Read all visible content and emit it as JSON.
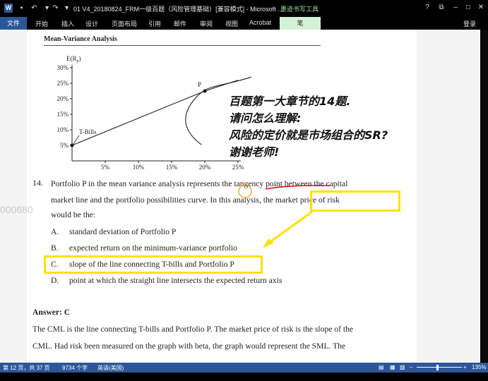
{
  "window": {
    "doc_title": "01 V4_20180824_FRM一级百题（风险管理基础）[兼容模式] - Microsoft ...",
    "tool_header": "墨迹书写工具",
    "controls": [
      "?",
      "⧉",
      "–",
      "□",
      "✕"
    ],
    "qat_icons": [
      "save-icon",
      "undo-icon",
      "redo-icon"
    ]
  },
  "ribbon": {
    "file_tab": "文件",
    "tabs": [
      "开始",
      "插入",
      "设计",
      "页面布局",
      "引用",
      "邮件",
      "审阅",
      "视图",
      "Acrobat"
    ],
    "pen_tab": "笔",
    "login": "登录"
  },
  "document": {
    "watermark": "000680",
    "section_title": "Mean-Variance Analysis",
    "chart_data": {
      "type": "line",
      "title": "Mean-Variance Analysis",
      "ylabel": "E(R",
      "ylabel_sub": "p",
      "ylabel_close": ")",
      "y_ticks": [
        "5%",
        "10%",
        "15%",
        "20%",
        "25%",
        "30%"
      ],
      "x_ticks": [
        "5%",
        "10%",
        "15%",
        "20%",
        "25%"
      ],
      "xlim": [
        0,
        25
      ],
      "ylim": [
        0,
        30
      ],
      "annotations": {
        "tbills": "T-Bills",
        "portfolio": "P"
      },
      "series": [
        {
          "values": [
            [
              0,
              5
            ],
            [
              20,
              22.5
            ],
            [
              25,
              26
            ]
          ]
        },
        {
          "values": [
            [
              19.5,
              5.2
            ],
            [
              16.5,
              10
            ],
            [
              16.5,
              15
            ],
            [
              18.5,
              20
            ],
            [
              22,
              23.5
            ],
            [
              27,
              27
            ]
          ]
        }
      ]
    },
    "note_lines": [
      "百题第一大章节的14题.",
      "请问怎么理解:",
      "风险的定价就是市场组合的SR?",
      "谢谢老师!"
    ],
    "question": {
      "number": "14.",
      "lines": [
        "Portfolio P in the mean variance analysis represents the tangency point between the capital",
        "market line and the portfolio possibilities curve. In this analysis, the market price of risk",
        "would be the:"
      ],
      "options": [
        {
          "letter": "A.",
          "text": "standard deviation of Portfolio P"
        },
        {
          "letter": "B.",
          "text": "expected return on the minimum-variance portfolio"
        },
        {
          "letter": "C.",
          "text": "slope of the line connecting T-bills and Portfolio P"
        },
        {
          "letter": "D.",
          "text": "point at which the straight line intersects the expected return axis"
        }
      ]
    },
    "answer": "Answer: C",
    "explanation": [
      "The CML is the line connecting T-bills and Portfolio P. The market price of risk is the slope of the",
      "CML. Had risk been measured on the graph with beta, the graph would represent the SML. The"
    ]
  },
  "statusbar": {
    "page": "第 12 页，共 37 页",
    "words": "9734 个字",
    "language": "英语(美国)",
    "zoom": "135%"
  },
  "colors": {
    "highlight": "#ffe100",
    "underline": "#d42020",
    "accent": "#2b579a"
  }
}
